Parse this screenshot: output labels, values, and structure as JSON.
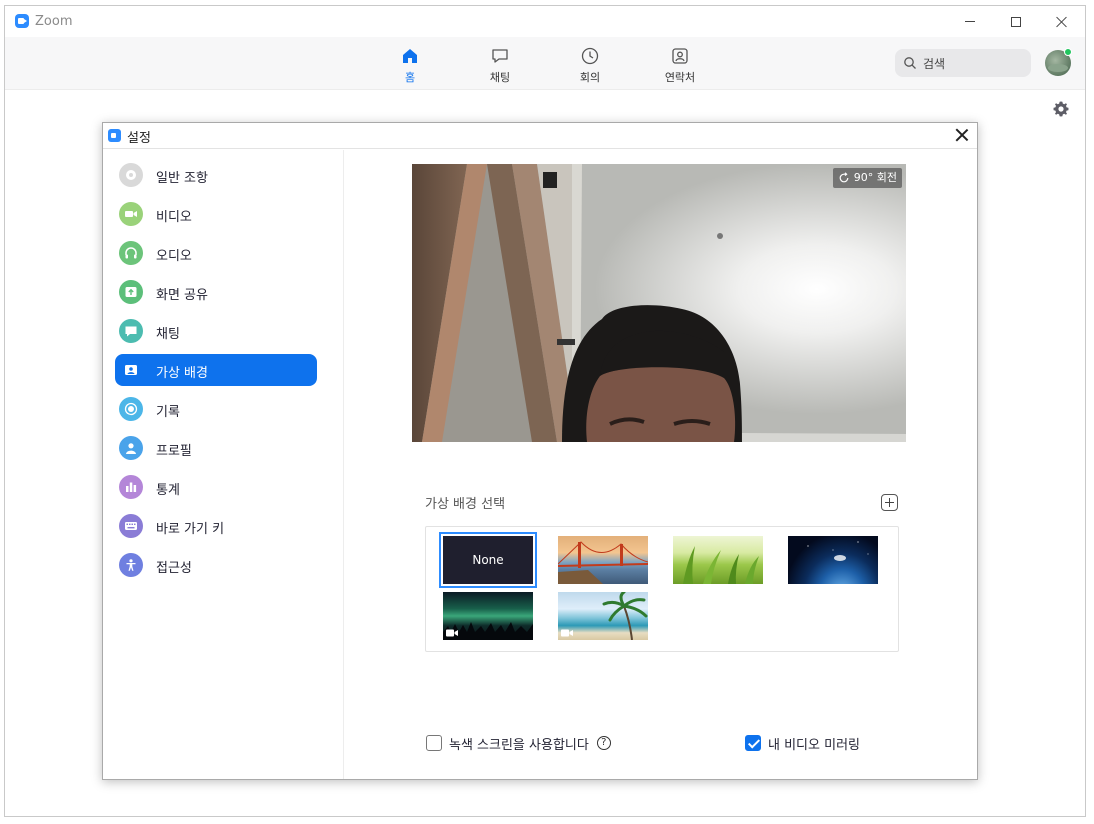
{
  "window": {
    "title": "Zoom"
  },
  "nav": {
    "tabs": [
      {
        "label": "홈",
        "icon": "home-icon",
        "active": true
      },
      {
        "label": "채팅",
        "icon": "chat-icon",
        "active": false
      },
      {
        "label": "회의",
        "icon": "clock-icon",
        "active": false
      },
      {
        "label": "연락처",
        "icon": "contacts-icon",
        "active": false
      }
    ],
    "search": {
      "placeholder": "검색"
    }
  },
  "settings": {
    "title": "설정",
    "sidebar": [
      {
        "label": "일반 조항",
        "icon": "gear-icon",
        "color": "#d9d9d9"
      },
      {
        "label": "비디오",
        "icon": "video-icon",
        "color": "#9ad27a"
      },
      {
        "label": "오디오",
        "icon": "headphones-icon",
        "color": "#6cc47a"
      },
      {
        "label": "화면 공유",
        "icon": "share-screen-icon",
        "color": "#5cbf7a"
      },
      {
        "label": "채팅",
        "icon": "chat-bubble-icon",
        "color": "#4cbcb0"
      },
      {
        "label": "가상 배경",
        "icon": "virtual-background-icon",
        "color": "#0e72ed",
        "active": true
      },
      {
        "label": "기록",
        "icon": "record-icon",
        "color": "#4cb6e8"
      },
      {
        "label": "프로필",
        "icon": "profile-icon",
        "color": "#4aa3ea"
      },
      {
        "label": "통계",
        "icon": "statistics-icon",
        "color": "#b486d8"
      },
      {
        "label": "바로 가기 키",
        "icon": "keyboard-icon",
        "color": "#8a7cd6"
      },
      {
        "label": "접근성",
        "icon": "accessibility-icon",
        "color": "#6f7fe0"
      }
    ],
    "virtual_background": {
      "preview": {
        "rotate_label": "90° 회전"
      },
      "choose_label": "가상 배경 선택",
      "backgrounds": [
        {
          "label": "None",
          "kind": "none",
          "selected": true
        },
        {
          "kind": "golden-gate-bridge",
          "video": false
        },
        {
          "kind": "grass",
          "video": false
        },
        {
          "kind": "earth-from-space",
          "video": false
        },
        {
          "kind": "aurora",
          "video": true
        },
        {
          "kind": "beach-palm",
          "video": true
        }
      ],
      "green_screen_label": "녹색 스크린을 사용합니다",
      "green_screen_checked": false,
      "help_glyph": "?",
      "mirror_label": "내 비디오 미러링",
      "mirror_checked": true
    }
  },
  "colors": {
    "accent": "#0e72ed",
    "presence": "#22c55e"
  }
}
